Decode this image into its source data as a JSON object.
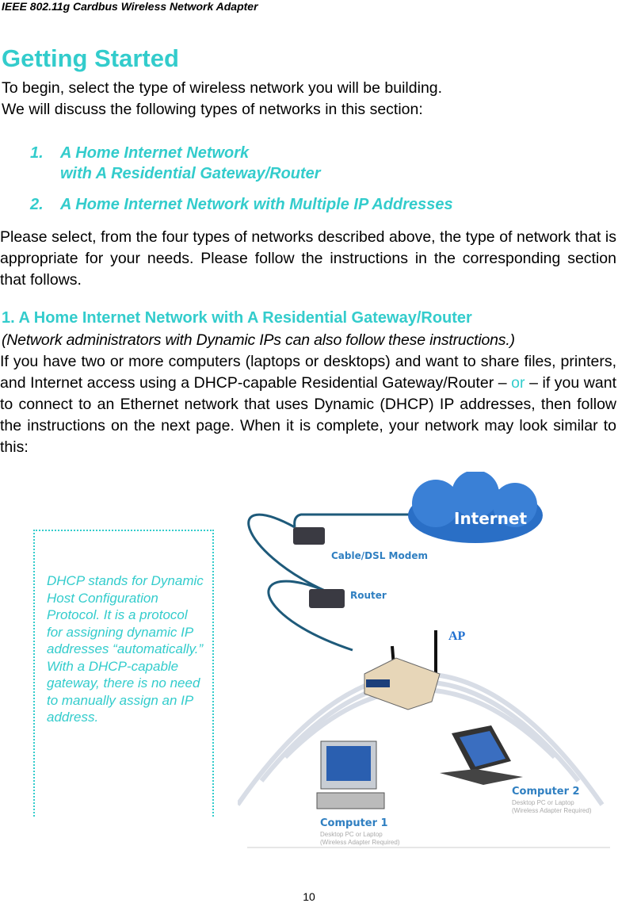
{
  "header": {
    "title": "IEEE 802.11g Cardbus Wireless Network Adapter"
  },
  "heading": "Getting Started",
  "intro": [
    "To begin, select the type of wireless network you will be building.",
    "We will discuss the following types of networks in this section:"
  ],
  "list": [
    {
      "num": "1.",
      "line1": "A Home Internet Network",
      "line2": "with A Residential Gateway/Router"
    },
    {
      "num": "2.",
      "line1": "A Home Internet Network with Multiple IP Addresses"
    }
  ],
  "select_paragraph": "Please select, from the four types of networks described above, the type of network that is appropriate for your needs. Please follow the instructions in the corresponding section that follows.",
  "section": {
    "heading": "1.  A Home Internet Network with A Residential Gateway/Router",
    "note": "(Network administrators with Dynamic IPs can also follow these instructions.)",
    "body_part1": "If you have two or more computers (laptops or desktops) and want to share files, printers, and Internet access using a DHCP-capable Residential Gateway/Router – ",
    "body_or": "or",
    "body_part2": " – if you want to connect to an Ethernet network that uses Dynamic (DHCP) IP addresses, then follow the instructions on the next page. When it is complete, your network may look similar to this:"
  },
  "sidebar_note": "DHCP stands for Dynamic Host Configuration Protocol. It is a protocol for assigning dynamic IP addresses “automatically.”  With a DHCP-capable gateway, there is no need to manually assign an IP address.",
  "diagram": {
    "internet": "Internet",
    "modem": "Cable/DSL Modem",
    "router": "Router",
    "ap": "AP",
    "computer1": {
      "title": "Computer 1",
      "line1": "Desktop PC or Laptop",
      "line2": "(Wireless Adapter Required)"
    },
    "computer2": {
      "title": "Computer 2",
      "line1": "Desktop PC or Laptop",
      "line2": "(Wireless Adapter Required)"
    }
  },
  "colors": {
    "accent": "#33cccc",
    "diagram_label": "#2f7fc1"
  },
  "page_number": "10"
}
